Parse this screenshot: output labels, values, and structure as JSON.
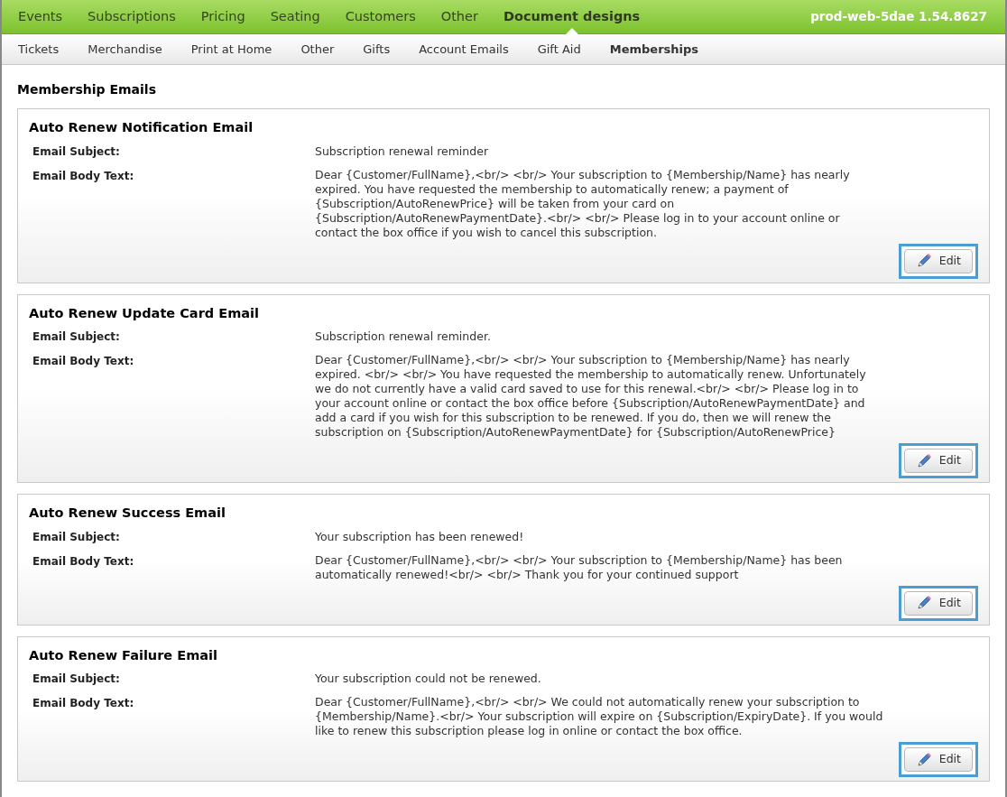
{
  "top_nav": {
    "items": [
      {
        "label": "Events",
        "selected": false
      },
      {
        "label": "Subscriptions",
        "selected": false
      },
      {
        "label": "Pricing",
        "selected": false
      },
      {
        "label": "Seating",
        "selected": false
      },
      {
        "label": "Customers",
        "selected": false
      },
      {
        "label": "Other",
        "selected": false
      },
      {
        "label": "Document designs",
        "selected": true
      }
    ],
    "server": "prod-web-5dae 1.54.8627"
  },
  "sub_nav": {
    "items": [
      {
        "label": "Tickets",
        "selected": false
      },
      {
        "label": "Merchandise",
        "selected": false
      },
      {
        "label": "Print at Home",
        "selected": false
      },
      {
        "label": "Other",
        "selected": false
      },
      {
        "label": "Gifts",
        "selected": false
      },
      {
        "label": "Account Emails",
        "selected": false
      },
      {
        "label": "Gift Aid",
        "selected": false
      },
      {
        "label": "Memberships",
        "selected": true
      }
    ]
  },
  "section_title": "Membership Emails",
  "emails": [
    {
      "title": "Auto Renew Notification Email",
      "subject_label": "Email Subject:",
      "subject": "Subscription renewal reminder",
      "body_label": "Email Body Text:",
      "body": "Dear {Customer/FullName},<br/> <br/> Your subscription to {Membership/Name} has nearly expired. You have requested the membership to automatically renew; a payment of {Subscription/AutoRenewPrice} will be taken from your card on {Subscription/AutoRenewPaymentDate}.<br/> <br/> Please log in to your account online or contact the box office if you wish to cancel this subscription.",
      "button": "Edit",
      "highlighted": true
    },
    {
      "title": "Auto Renew Update Card Email",
      "subject_label": "Email Subject:",
      "subject": "Subscription renewal reminder.",
      "body_label": "Email Body Text:",
      "body": "Dear {Customer/FullName},<br/> <br/> Your subscription to {Membership/Name} has nearly expired. <br/> <br/> You have requested the membership to automatically renew. Unfortunately we do not currently have a valid card saved to use for this renewal.<br/> <br/> Please log in to your account online or contact the box office before {Subscription/AutoRenewPaymentDate} and add a card if you wish for this subscription to be renewed. If you do, then we will renew the subscription on {Subscription/AutoRenewPaymentDate} for {Subscription/AutoRenewPrice}",
      "button": "Edit",
      "highlighted": true
    },
    {
      "title": "Auto Renew Success Email",
      "subject_label": "Email Subject:",
      "subject": "Your subscription has been renewed!",
      "body_label": "Email Body Text:",
      "body": "Dear {Customer/FullName},<br/> <br/> Your subscription to {Membership/Name} has been automatically renewed!<br/> <br/> Thank you for your continued support",
      "button": "Edit",
      "highlighted": true
    },
    {
      "title": "Auto Renew Failure Email",
      "subject_label": "Email Subject:",
      "subject": "Your subscription could not be renewed.",
      "body_label": "Email Body Text:",
      "body": "Dear {Customer/FullName},<br/> <br/> We could not automatically renew your subscription to {Membership/Name}.<br/> Your subscription will expire on {Subscription/ExpiryDate}. If you would like to renew this subscription please log in online or contact the box office.",
      "button": "Edit",
      "highlighted": true
    }
  ]
}
